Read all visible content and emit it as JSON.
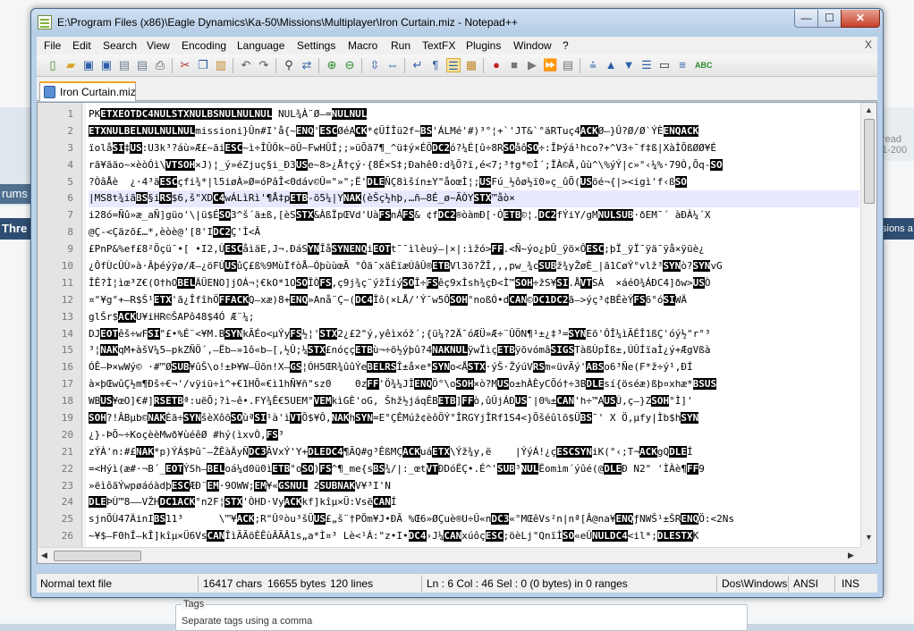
{
  "background": {
    "left_labels": [
      "rums",
      "Thre"
    ],
    "right_labels": [
      "read",
      "1-200",
      "sions a"
    ],
    "tags_legend": "Tags",
    "tags_hint": "Separate tags using a comma"
  },
  "window": {
    "title": "E:\\Program Files (x86)\\Eagle Dynamics\\Ka-50\\Missions\\Multiplayer\\Iron Curtain.miz - Notepad++",
    "controls": {
      "minimize": "—",
      "maximize": "☐",
      "close": "✕"
    }
  },
  "menu": {
    "items": [
      "File",
      "Edit",
      "Search",
      "View",
      "Encoding",
      "Language",
      "Settings",
      "Macro",
      "Run",
      "TextFX",
      "Plugins",
      "Window",
      "?"
    ],
    "close_doc": "X"
  },
  "toolbar": {
    "icons": [
      "new-file-icon",
      "open-file-icon",
      "save-icon",
      "save-all-icon",
      "close-icon",
      "close-all-icon",
      "print-icon",
      "cut-icon",
      "copy-icon",
      "paste-icon",
      "undo-icon",
      "redo-icon",
      "find-icon",
      "replace-icon",
      "zoom-in-icon",
      "zoom-out-icon",
      "sync-vertical-icon",
      "sync-horizontal-icon",
      "word-wrap-icon",
      "show-all-chars-icon",
      "indent-guide-icon",
      "user-lang-icon",
      "record-macro-icon",
      "stop-record-icon",
      "play-macro-icon",
      "play-multiple-icon",
      "save-macro-icon",
      "trim-icon",
      "move-up-icon",
      "move-down-icon",
      "indent-icon",
      "run-icon",
      "spellcheck-icon"
    ]
  },
  "tab": {
    "label": "Iron Curtain.miz"
  },
  "editor": {
    "current_line": 6,
    "lines": [
      {
        "n": "1",
        "t": "PK[ETX][EOT][DC4][NUL][STX][NUL][BS][NUL][NUL][NUL] NUL¾À¨Ø–=[NUL][NUL]"
      },
      {
        "n": "2",
        "t": "[ETX][NUL][BEL][NUL][NUL][NUL]missioni}Ûn#I'å{~[ENQ]'[ESC]ØéA[CK]*¢ÜÍÎü2f~[BS]'ÁLMé'#)³°¦+`'JT&`°äRTuç4[ACK]Ø—}Û?Ø/Ø`ÝÈ[ENQ][ACK]"
      },
      {
        "n": "3",
        "t": "ïolå[SI]‡[US]:U3k³?áù»Æ£~ãi[ESC]~ì÷ÎÛÔk~öÛ~FwHÛÎ;;»üÕã7¶_^ü‡ý×ÉÖ[DC2]ó?¼É[û÷8R[SO]åô[SO]÷:ÎÞýá¹hco?+^V3÷¯f‡ß|XàÌÕßØØ¥É"
      },
      {
        "n": "4",
        "t": "rã¥ãäo~×èòÓì\\[VT][SOH]×J)¦_ý»éZjuç§i_Ð3[US]e~8>¿Å†çý·{8É×S‡;Ðahê0:d¾Õ?ï,é<7;³†g*©Ì´;ÏÀ©Ä,ûù^\\%ýÝ|c»°‹¼%·79Ò,Õq-[SO]"
      },
      {
        "n": "5",
        "t": "?ÒâÅè  ¿·4³ä[ESC]çfi¾*|l5iøÀ»Ø=óPâÎ<0dáv©Û=\"»\";Ë'[DLE]ÑÇ8ìšín±Y\"åoœÌ¦;[US]Fú_½ôø½ï0»ç_ûÕ([US]öé¬{|><igì'f‹ß[SO]"
      },
      {
        "n": "6",
        "t": "|MS8t¾iã[BS]§i[RS]$6,š\"XD[C4]wÁLìRì'¶Å‡p[ETB]-õ5¼|Y[NAK](èŠç½hþ,…ñ—8É_ø~ÃÒY[STX]™åò×"
      },
      {
        "n": "7",
        "t": "i28ó=Ñû»æ_aÑ]güo'\\|ü$É[SO]3^š´ä±ß,[èS[STX]&ÀßÏpŒVd'Uà[FS]nÁ[FS]& ¢f[DC2]®òàmÐ[·Ó[ETB]©¦.[DC2]fÝiY/gM[NUL][SUB]·ðEM¯´ àÐÀ¼´X"
      },
      {
        "n": "8",
        "t": "@Ç-<Çäzõ£…*,èòè@'[8'I[DC2]Ç'Ì<Â"
      },
      {
        "n": "9",
        "t": "£PnP&%ef£8²Öçü¯•[ •I2,Ù[ESC]åìäE,J¬.ÐáS[YN]Îå[SYN][ENQ]i[EOT]t¯¯ìlèuý–|×|:ìžó>[FF].<Ñ~ýo¿þÛ_ÿö×Ô[ESC];þÏ_ÿÏ¯ÿä¯ÿå×ÿüè¿"
      },
      {
        "n": "10",
        "t": "¿ÔfÙcÛÙ»à·Âþéýÿø/Æ–¿öFÙ[US]ûÇ£ß%9MùÏfòÅ–ÓþùùœÃ °Óä¯xäÈïæÚâÛ®[ETB]Vl3ö?ŽÎ,,,pw_¾c[SUB]ž¾yŽøÈ_|ã1CøÝ°vlž³[SYN]ò?[SYN]vG"
      },
      {
        "n": "11",
        "t": "ÎÊ?Ì¦ìœ³Z€(O†hO[BEL]ÄÜENO]jOÁ¬¦€kO*1O[SO]ÎÒ[FS],ç9j¾ç¨ýžÎíý[SO]Î÷[FS]êç9xÌsh¾çÐ<Ì™[SOH]÷žS¥[SI].Å[VT]SÀ  ×áéO¾ÁÐC4]ðw>[US]Ò"
      },
      {
        "n": "12",
        "t": "¤\"¥g°+–R$Š¹[ETX]'ã¿ÎfîhÖ[FF][ACK]Q–xæ)8+[ENQ]»Anå¨Ç~([DC4]Îô(×LÅ/'Ý¯w5Ô[SOH]°noßÓ•d[CAN]©[DC1][DC2]ã–>ýç³¢BÊèÝ[FS]6°ó[SI]WÄ"
      },
      {
        "n": "13",
        "t": "glŠr$[ACK]U¥iHR©ŠAPô48$4Ó Æ¨¼;"
      },
      {
        "n": "14",
        "t": "DJ[EOT]êš÷wF[SI]\"£•%É¨<¥M.B[SYN]kÃÉo<µÝy[FS]½¦'[STX]2¿£2\"ý,yêìxóž´;{ü¼?2Ä¯óÆÜ»Æ÷¨ÛÖN¶¹±¿‡³=[SYN]Eõ'ÔÎ¼ìÃÉÎ1ßÇ'óý½\"r°³"
      },
      {
        "n": "15",
        "t": "³¦[NAK]qM+àšV¼5–pkZÑÖ´,–Ëb–»1ô«b–[,½Û;¼[STX]£nóçç[ETB]ù¬÷ö½ýþû?4[NAK][NUL]ÿwÏìç[ETB]ÿõvómâ[SI][GS]TàßÙpÎß±,ÚÛÍïaÌ¿ý+ÆgVßà"
      },
      {
        "n": "16",
        "t": "ÓÊ–Þ×wWý© ·#™Ø[SUB]¥ûŠ\\o!±Þ¥W–Üõn!X–[GS]¦ÓH5ŒR¾ûûÝe[BEL][RS]Î±å×e*[SYN]o<Å[STX]·ýŠ·ŽýúV[RS]m«üvÃý'[ABS]o6³Ñe(F*ž÷ý¹,ÐÍ"
      },
      {
        "n": "17",
        "t": "à×þŒwûÇ½m¶Ðš÷€¬'/vÿiü÷ì^+€1HÕ«€ì1hÑ¥ñ\"sz0    0z[FF]'Ö¾¼JÎ[ENQ]Ö°\\o[SOH]×ò?M[US]o±hÀÈyCÕó†÷3B[DLE]sí{öséæ)ßþ¤xhæ*[BS][US]"
      },
      {
        "n": "18",
        "t": "WB[US]¥œO]€#][RS][ETB]ª:uëÕ;?ì~ê•.FY¾Ê€5UEM°[VEM]kìGÈ'oG, Šhž½jáqÊB[ETB]][FF]ò,ûÛjÁÐ[US]¯|0%±[CAN]'h÷™A[US]Ú,ç–}Z[SOH]°Ì]'"
      },
      {
        "n": "19",
        "t": "[SOH]?!ÂBµb©[NAK]Èã÷[SYN]šèXôõ[SO]ùª[SI]¹à'ì[VT]Õ$¥Ô,[NAK]h[SYN]=E°ÇÊMúž¢èôÖÝ°ÎRGYjÎRf1S4<}Õšéûlõ$Ü[BS]¯' X Ö,µfy|Ìb$h[SYN]"
      },
      {
        "n": "20",
        "t": "¿}-ÞÕ~÷KoçèèMwð¥ùéêØ #hý(ìxvÒ,[FS]³"
      },
      {
        "n": "21",
        "t": "zÝÀ'n:#£[NAK]*p)ÝÁ$Þû¯–ŽÊàÄyÑ[DC3]ÃVxÝ'Y+[DLE][DC4]¶ÃQ#g³ÊßMÇ[ACK]uá[ETX]\\Ýž¾y,ë    |ÝýÁ!¿ç[ESC][SYN]iK(°‹;T¬[ACK]gQ[DLE]Í"
      },
      {
        "n": "22",
        "t": "=<Hýì(æ#·¬B´_[EOT]ÝSh—[BEL]oá¼d0ü0ì[ETB]°o[SO])[FS]^¶_me{s[BS]¾/|:_œt[VT]ÐDóËÇ•.É^'[SUB]³[NUL]Ëomìm´ýûé(@[DLE]Ð N2\" 'ÌÀè¶[FF]9"
      },
      {
        "n": "23",
        "t": "»ëìôãÝwpøáóàdþ[ESC]ÆÐ¨[EM]·9OWW;[EM]¥«[GS][NUL] 2[SUB][NAK]V¥³I'N"
      },
      {
        "n": "24",
        "t": "[DLE]ÞÙ™8—–VŽH[DC1][ACK]°n2F¦[STX]'ÒHD·Vy[ACK]kf]kîµ×Ü:Vsë[CAN]Í"
      },
      {
        "n": "25",
        "t": "sjnÕÙ47ÄinI[BS]11³      \\™¥[ACK];R\"Ûºòu³šÜ[US]£„š¨†PÕm¥J•ÐÃ %Œ6»ØÇuè®U÷Û«n[DC3]«°MŒêVs²n|nª[Â@na¥[ENQ]ƒNWŠ¹±ŠR[ENQ]Ö:<2Ns"
      },
      {
        "n": "26",
        "t": "~¥$–F0hÎ–kÎ]kîµ×Ü6Vs[CAN]ÎìÃÃöÈÊùÂÃÂ1s„a*Ì¤³ Lè<¹Á:\"z•I•[DC4]›J¼[CAN]xúôç[ESC];öèLj\"QnïÌ[SO]«eÛ[NUL][DC4]<il*;[DLE][STX]K"
      },
      {
        "n": "27",
        "t": "«[DC2]äd[FS]}[NUL][DC1]BtJ,IÁ£MÁýÄ"
      },
      {
        "n": "28",
        "t": "[EM]<¸ÁÉÓÜ¾é|r[NUL]°NUL¸ÖëÊ[EOT]M·Ê·Í·F"
      }
    ]
  },
  "scroll": {
    "up": "▲",
    "down": "▼",
    "left": "◀",
    "right": "▶"
  },
  "status": {
    "file_type": "Normal text file",
    "chars": "16417 chars",
    "bytes": "16655 bytes",
    "lines": "120 lines",
    "position": "Ln : 6    Col : 46    Sel : 0 (0 bytes) in 0 ranges",
    "eol": "Dos\\Windows",
    "encoding": "ANSI",
    "mode": "INS"
  }
}
